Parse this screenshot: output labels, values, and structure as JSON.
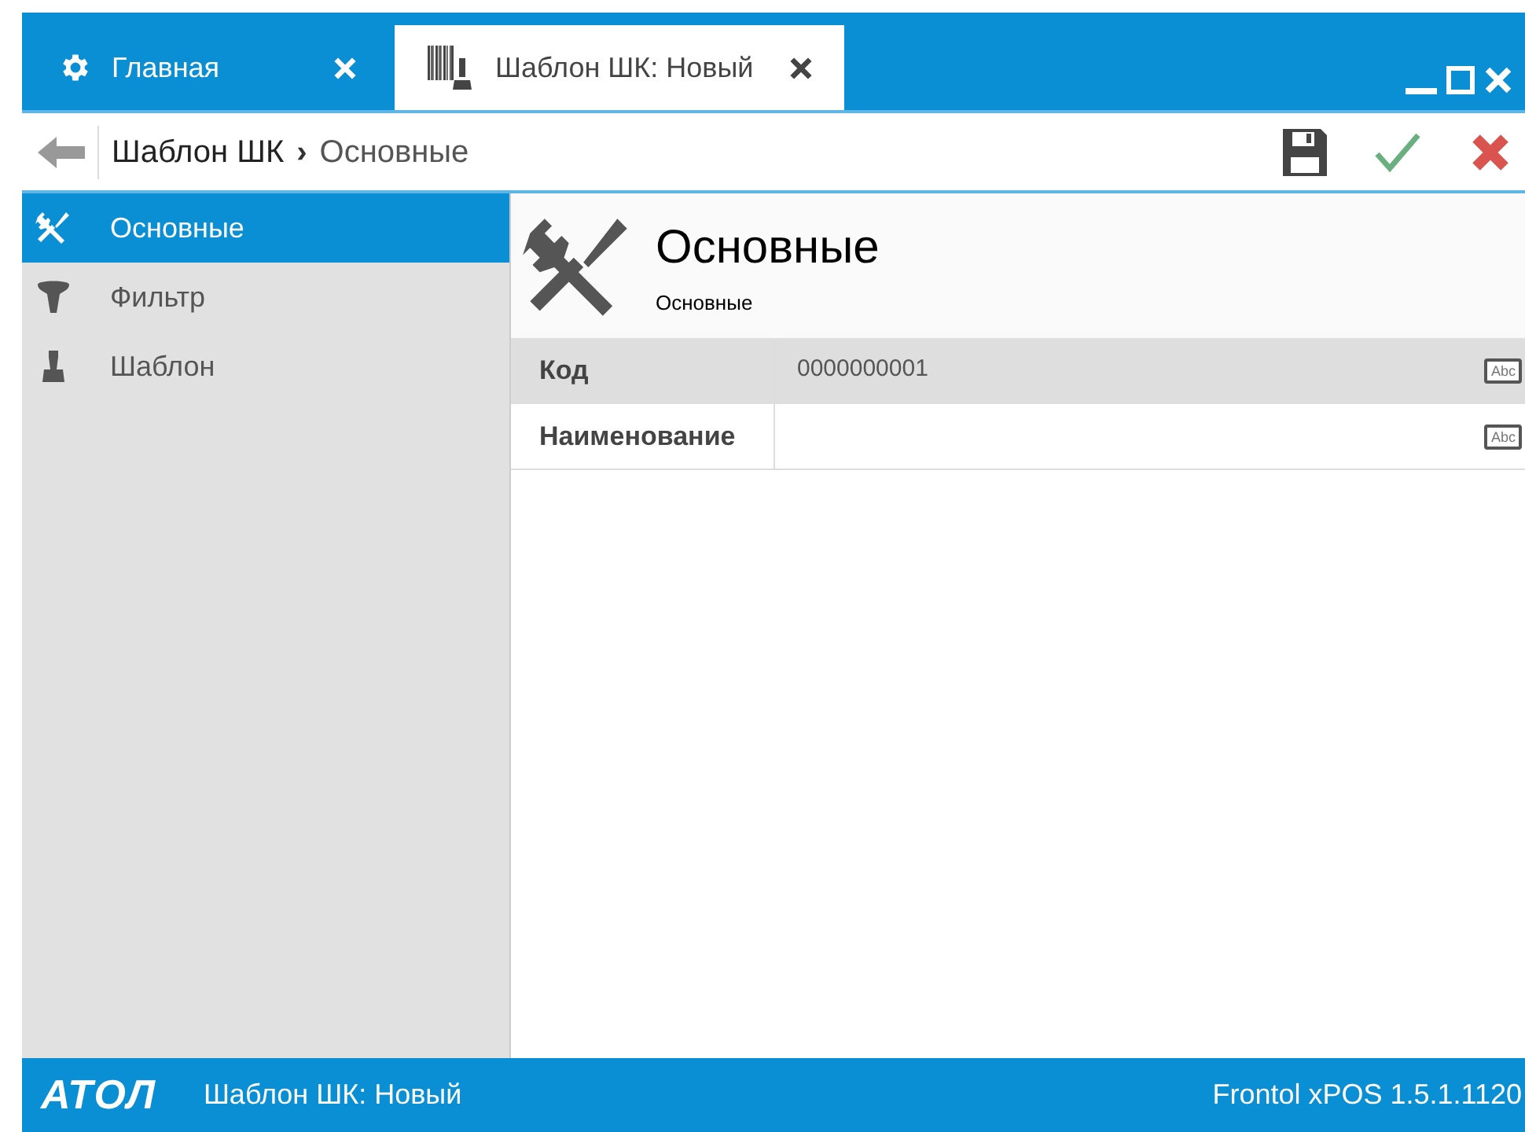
{
  "tabs": [
    {
      "label": "Главная",
      "selected": false
    },
    {
      "label": "Шаблон ШК: Новый",
      "selected": true
    }
  ],
  "breadcrumb": {
    "parent": "Шаблон ШК",
    "separator": "›",
    "current": "Основные"
  },
  "sidebar": {
    "items": [
      {
        "label": "Основные",
        "selected": true
      },
      {
        "label": "Фильтр",
        "selected": false
      },
      {
        "label": "Шаблон",
        "selected": false
      }
    ]
  },
  "section": {
    "title": "Основные",
    "subtitle": "Основные"
  },
  "fields": [
    {
      "label": "Код",
      "value": "0000000001",
      "badge": "Abc",
      "selected": true
    },
    {
      "label": "Наименование",
      "badge": "Abc",
      "selected": false
    }
  ],
  "status_bar": {
    "logo": "АТОЛ",
    "document": "Шаблон ШК: Новый",
    "version": "Frontol xPOS 1.5.1.1120"
  }
}
